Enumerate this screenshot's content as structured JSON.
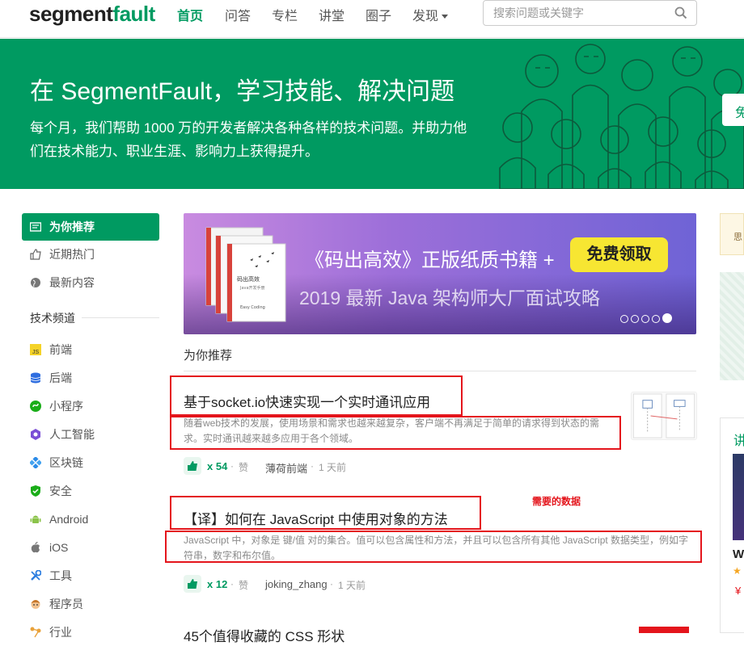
{
  "header": {
    "logo_prefix": "segment",
    "logo_suffix": "fault",
    "nav": [
      {
        "label": "首页",
        "active": true
      },
      {
        "label": "问答"
      },
      {
        "label": "专栏"
      },
      {
        "label": "讲堂"
      },
      {
        "label": "圈子"
      },
      {
        "label": "发现",
        "dropdown": true
      }
    ],
    "search_placeholder": "搜索问题或关键字"
  },
  "hero": {
    "title": "在 SegmentFault，学习技能、解决问题",
    "subtitle": "每个月，我们帮助 1000 万的开发者解决各种各样的技术问题。并助力他们在技术能力、职业生涯、影响力上获得提升。",
    "button_partial": "免"
  },
  "sidebar": {
    "items": [
      {
        "label": "为你推荐",
        "icon": "recommend-icon",
        "active": true
      },
      {
        "label": "近期热门",
        "icon": "thumbs-up-icon"
      },
      {
        "label": "最新内容",
        "icon": "globe-icon"
      }
    ],
    "channels_heading": "技术频道",
    "channels": [
      {
        "label": "前端",
        "icon": "js-icon",
        "color": "#f5d328"
      },
      {
        "label": "后端",
        "icon": "database-icon",
        "color": "#2f6ee0"
      },
      {
        "label": "小程序",
        "icon": "miniprogram-icon",
        "color": "#1aad19"
      },
      {
        "label": "人工智能",
        "icon": "ai-icon",
        "color": "#7b4fd6"
      },
      {
        "label": "区块链",
        "icon": "blockchain-icon",
        "color": "#2b8be8"
      },
      {
        "label": "安全",
        "icon": "shield-icon",
        "color": "#1aad19"
      },
      {
        "label": "Android",
        "icon": "android-icon",
        "color": "#8bc34a"
      },
      {
        "label": "iOS",
        "icon": "apple-icon",
        "color": "#777777"
      },
      {
        "label": "工具",
        "icon": "tools-icon",
        "color": "#2b7de0"
      },
      {
        "label": "程序员",
        "icon": "programmer-icon",
        "color": "#c7772a"
      },
      {
        "label": "行业",
        "icon": "industry-icon",
        "color": "#e9a23b"
      }
    ]
  },
  "banner": {
    "text_main": "《码出高效》正版纸质书籍 +",
    "button": "免费领取",
    "text_sub": "2019 最新 Java 架构师大厂面试攻略",
    "book_title": "码出高效",
    "book_sub": "Java开发手册",
    "book_tag": "Easy Coding",
    "slides": 5,
    "active_slide": 5
  },
  "feed": {
    "section_title": "为你推荐",
    "articles": [
      {
        "title": "基于socket.io快速实现一个实时通讯应用",
        "summary": "随着web技术的发展，使用场景和需求也越来越复杂，客户端不再满足于简单的请求得到状态的需求。实时通讯越来越多应用于各个领域。",
        "likes": "x 54",
        "like_label": "赞",
        "author": "薄荷前端",
        "time": "1 天前"
      },
      {
        "title": "【译】如何在 JavaScript 中使用对象的方法",
        "summary": "JavaScript 中，对象是 键/值 对的集合。值可以包含属性和方法，并且可以包含所有其他 JavaScript 数据类型，例如字符串，数字和布尔值。",
        "likes": "x 12",
        "like_label": "赞",
        "author": "joking_zhang",
        "time": "1 天前"
      },
      {
        "title": "45个值得收藏的 CSS 形状"
      }
    ],
    "annotation": "需要的数据",
    "meta_separator": "·"
  },
  "right": {
    "card_text": "思",
    "heading_partial": "讲",
    "title_partial": "W",
    "price_partial": "¥"
  },
  "colors": {
    "brand": "#009a61",
    "annotation": "#e4151c"
  }
}
